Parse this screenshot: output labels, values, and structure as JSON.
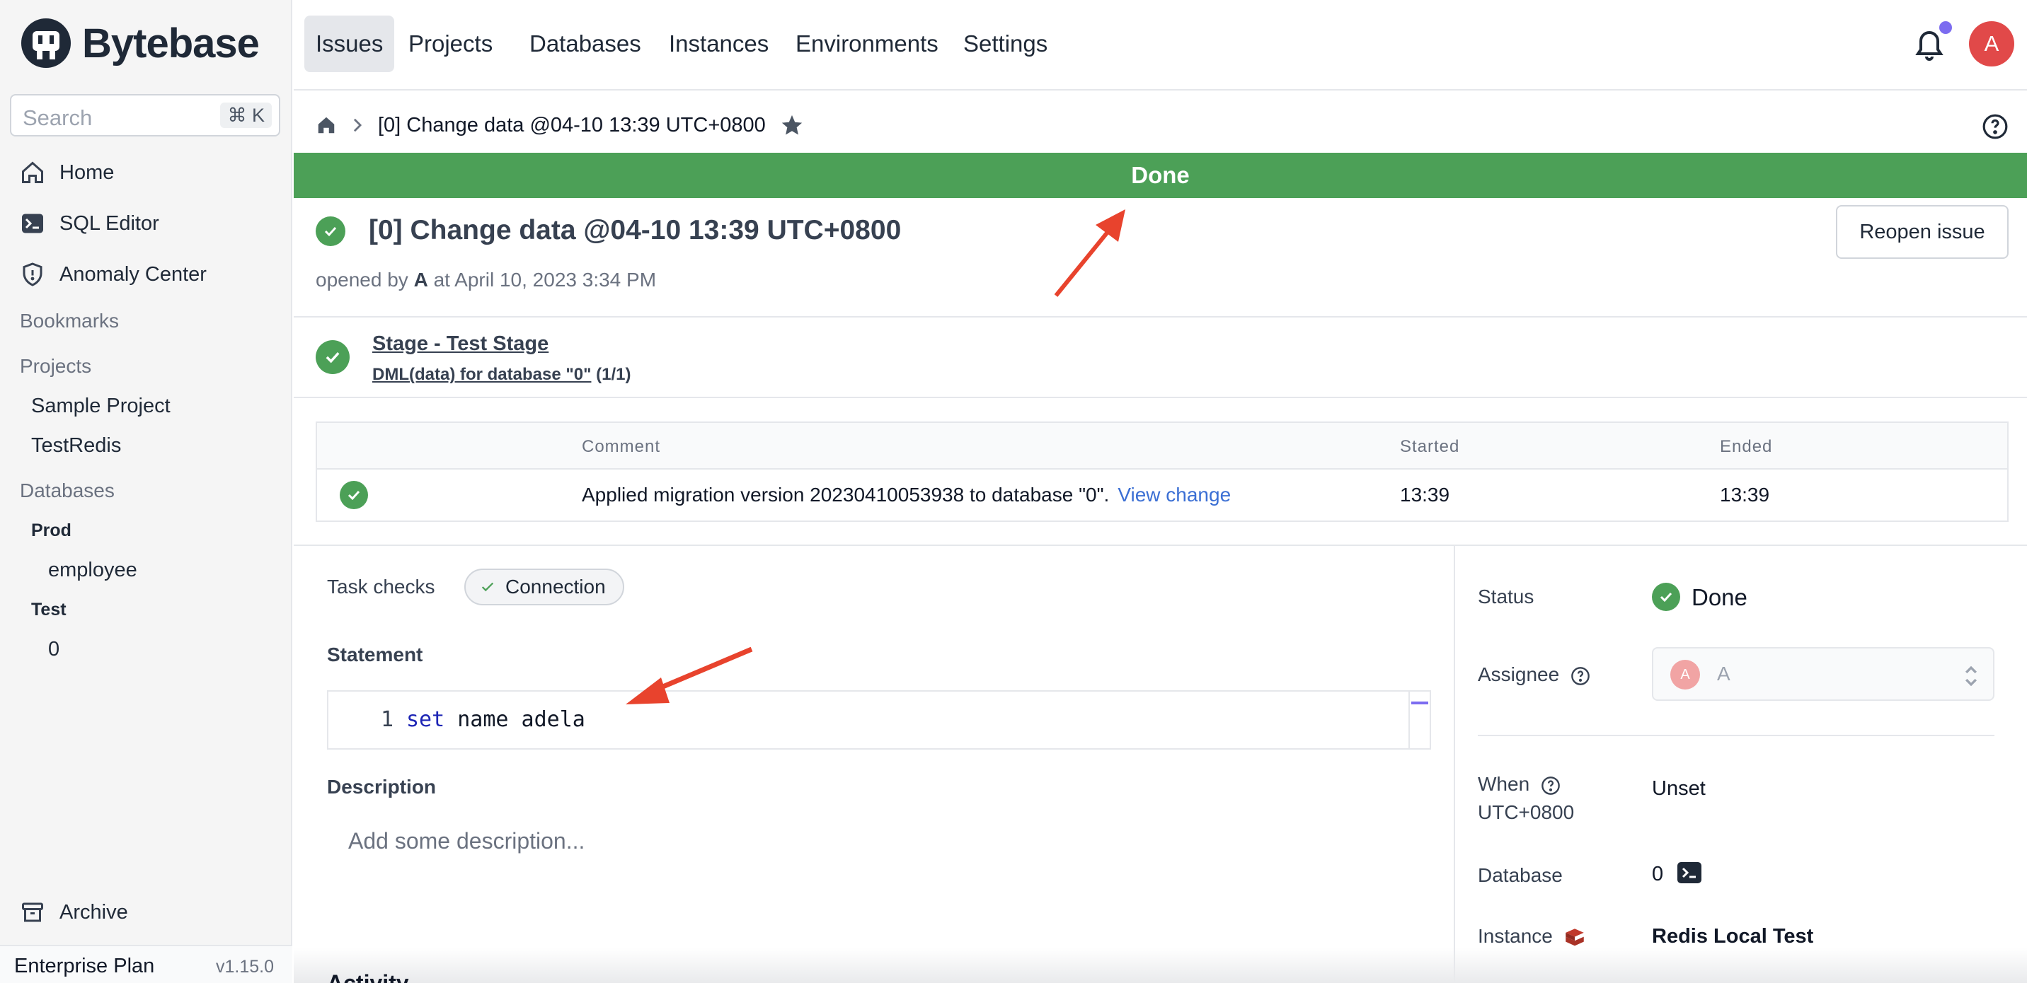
{
  "app": {
    "name": "Bytebase"
  },
  "sidebar": {
    "search_placeholder": "Search",
    "search_shortcut": "⌘ K",
    "nav": [
      {
        "label": "Home",
        "icon": "home-icon"
      },
      {
        "label": "SQL Editor",
        "icon": "terminal-icon"
      },
      {
        "label": "Anomaly Center",
        "icon": "shield-icon"
      }
    ],
    "bookmarks_label": "Bookmarks",
    "projects_label": "Projects",
    "projects": [
      "Sample Project",
      "TestRedis"
    ],
    "databases_label": "Databases",
    "environments": [
      {
        "name": "Prod",
        "databases": [
          "employee"
        ]
      },
      {
        "name": "Test",
        "databases": [
          "0"
        ]
      }
    ],
    "archive_label": "Archive",
    "plan": "Enterprise Plan",
    "version": "v1.15.0"
  },
  "topnav": {
    "items": [
      "Issues",
      "Projects",
      "Databases",
      "Instances",
      "Environments",
      "Settings"
    ],
    "active": "Issues",
    "avatar_initial": "A"
  },
  "breadcrumb": {
    "current": "[0] Change data @04-10 13:39 UTC+0800"
  },
  "banner": {
    "text": "Done",
    "color": "#4ca057"
  },
  "issue": {
    "title": "[0] Change data @04-10 13:39 UTC+0800",
    "opened_prefix": "opened by",
    "opened_by": "A",
    "opened_suffix": "at April 10, 2023 3:34 PM",
    "reopen_label": "Reopen issue"
  },
  "stage": {
    "title": "Stage - Test Stage",
    "task_link": "DML(data) for database \"0\"",
    "task_count": "(1/1)"
  },
  "task_table": {
    "headers": {
      "comment": "Comment",
      "started": "Started",
      "ended": "Ended"
    },
    "rows": [
      {
        "comment": "Applied migration version 20230410053938 to database \"0\".",
        "link": "View change",
        "started": "13:39",
        "ended": "13:39"
      }
    ]
  },
  "task_checks": {
    "label": "Task checks",
    "chip": "Connection"
  },
  "statement": {
    "label": "Statement",
    "line_number": "1",
    "keyword": "set",
    "rest": " name adela"
  },
  "description": {
    "label": "Description",
    "placeholder": "Add some description..."
  },
  "activity_label": "Activity",
  "panel": {
    "status_label": "Status",
    "status_value": "Done",
    "assignee_label": "Assignee",
    "assignee_initial": "A",
    "assignee_name": "A",
    "when_label": "When",
    "when_tz": "UTC+0800",
    "when_value": "Unset",
    "database_label": "Database",
    "database_value": "0",
    "instance_label": "Instance",
    "instance_value": "Redis Local Test"
  },
  "colors": {
    "success": "#4ca057",
    "link": "#3b6fd4",
    "avatar": "#e14949",
    "annotation_arrow": "#e8432d"
  }
}
